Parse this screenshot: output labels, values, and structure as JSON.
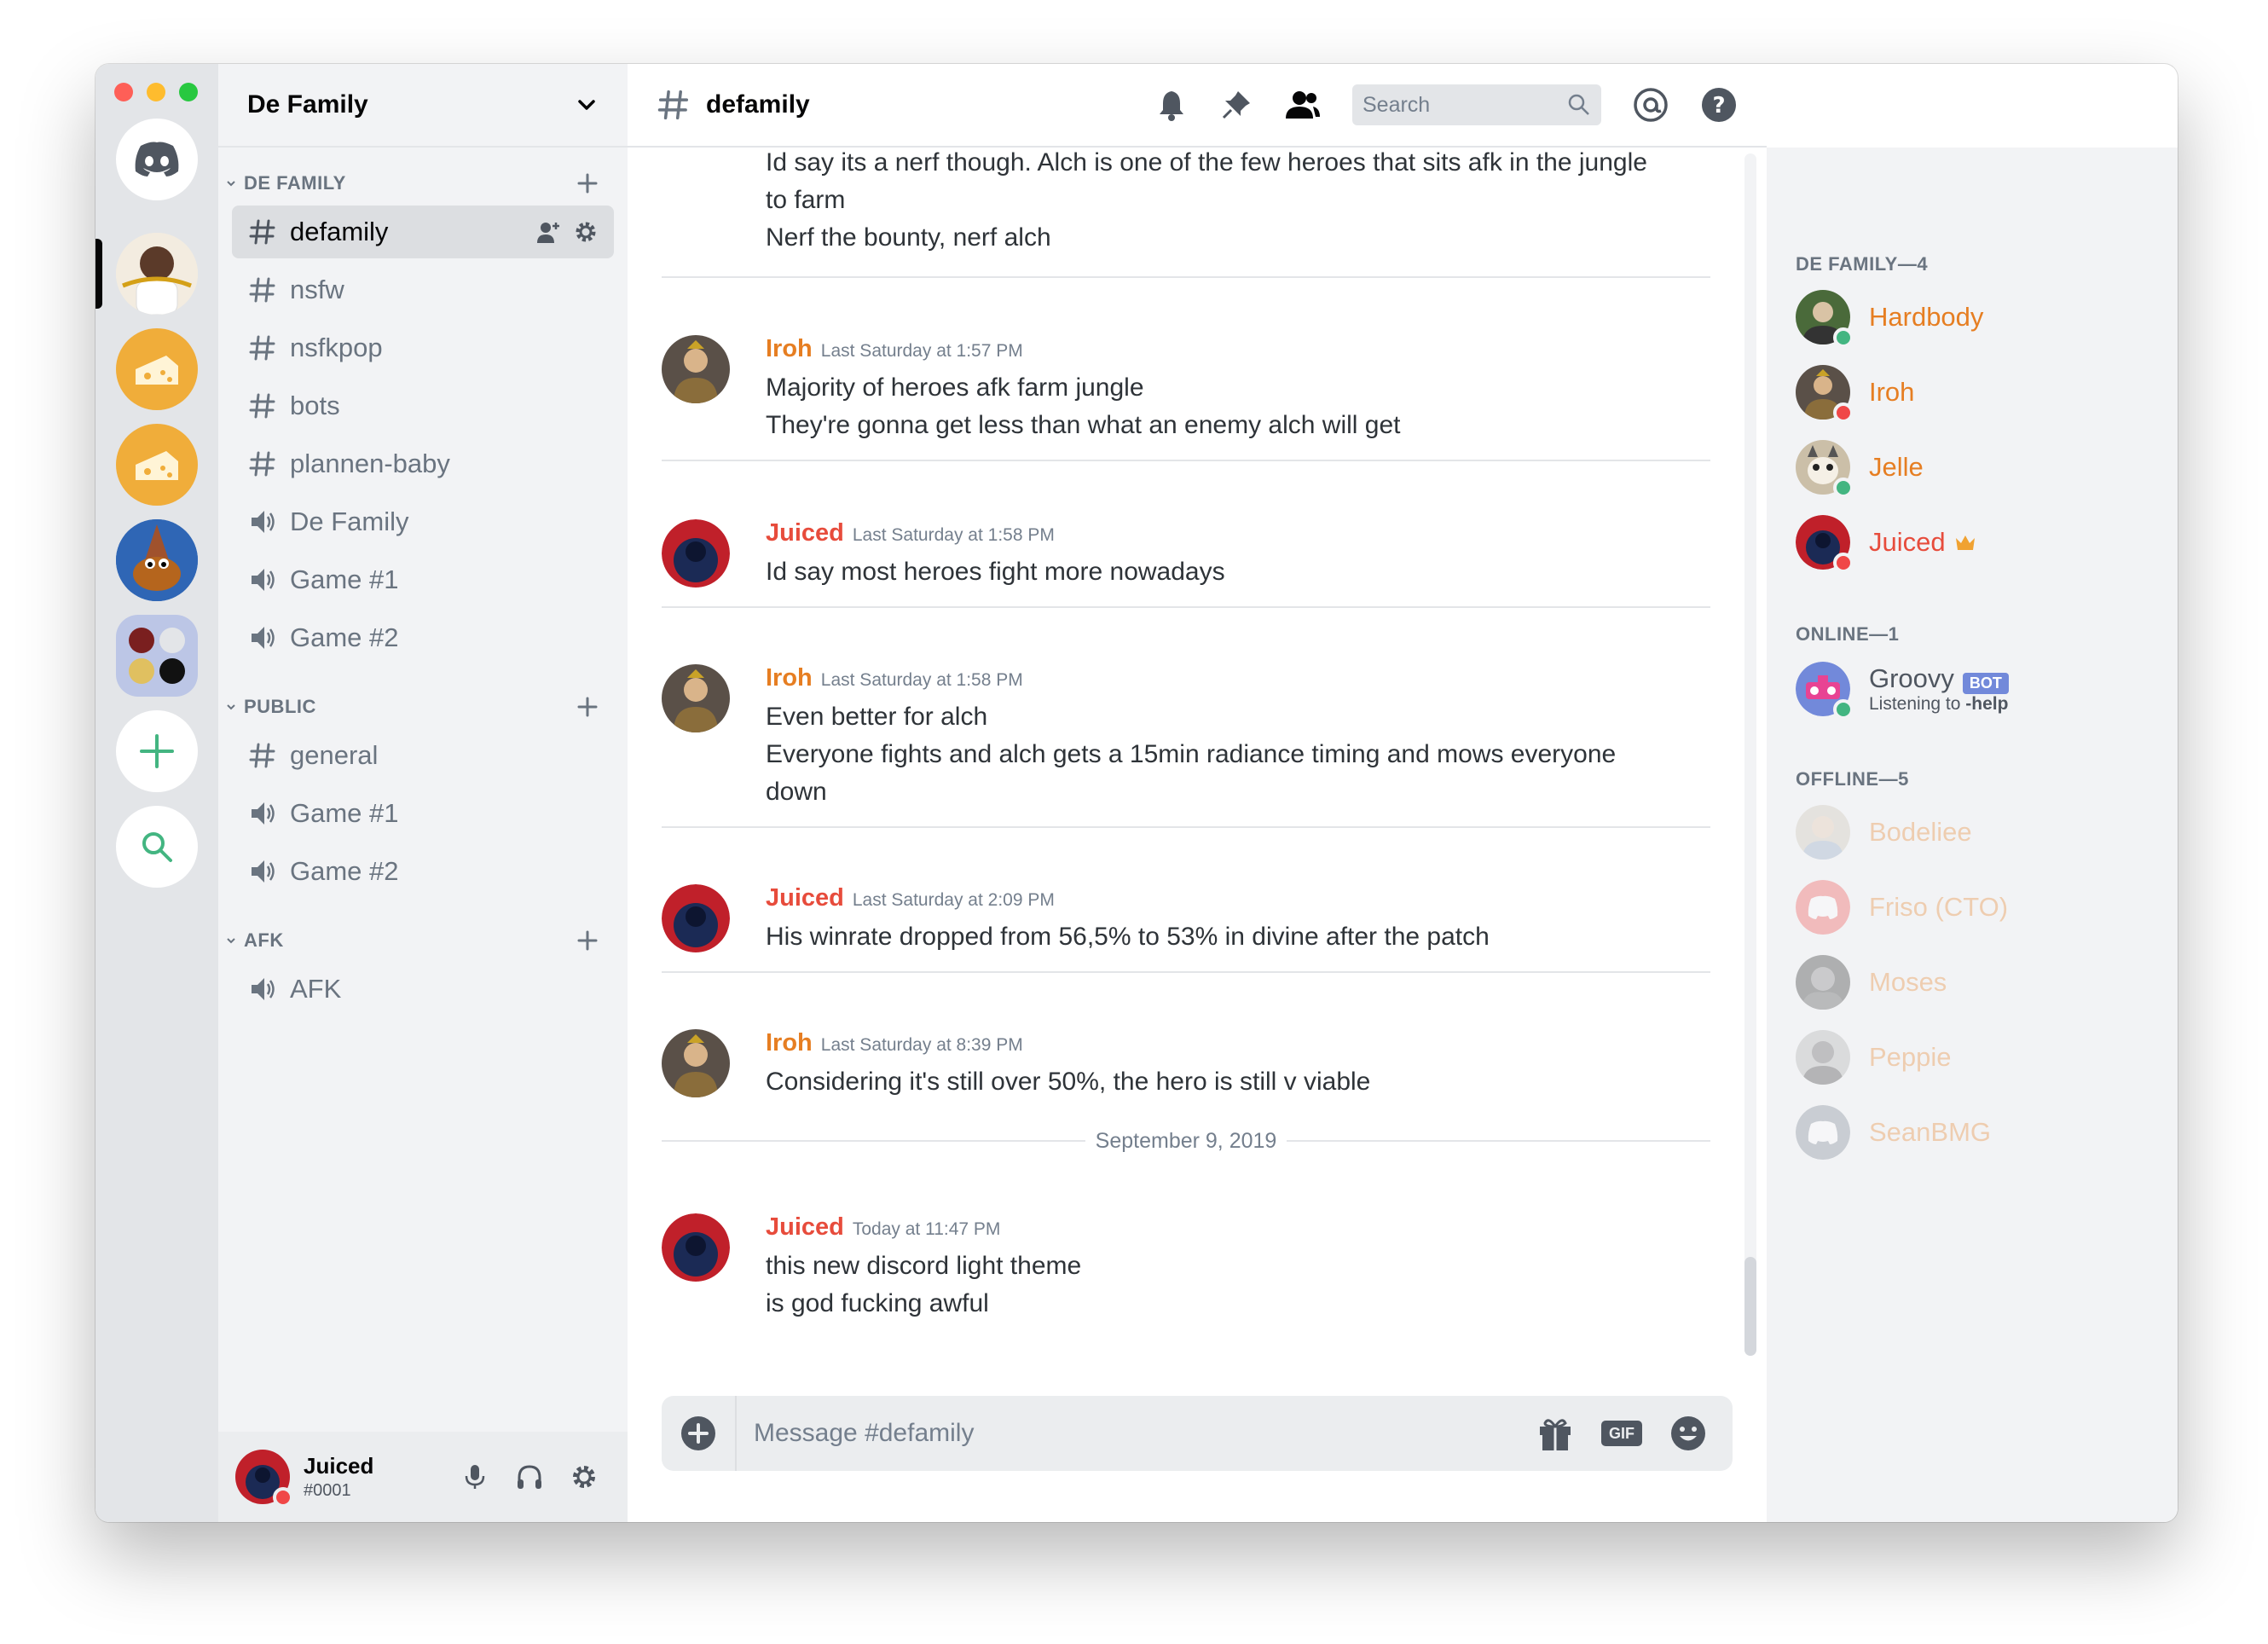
{
  "guild": {
    "name": "De Family"
  },
  "categories": [
    {
      "name": "DE FAMILY",
      "channels": [
        "defamily",
        "nsfw",
        "nsfkpop",
        "bots",
        "plannen-baby",
        "De Family",
        "Game #1",
        "Game #2"
      ]
    },
    {
      "name": "PUBLIC",
      "channels": [
        "general",
        "Game #1",
        "Game #2"
      ]
    },
    {
      "name": "AFK",
      "channels": [
        "AFK"
      ]
    }
  ],
  "user": {
    "name": "Juiced",
    "tag": "#0001"
  },
  "chat": {
    "channel": "defamily",
    "search_placeholder": "Search",
    "composer_placeholder": "Message #defamily",
    "gif_label": "GIF",
    "date_divider": "September 9, 2019"
  },
  "messages": [
    {
      "author": "",
      "timestamp": "",
      "lines": [
        "Id say its a nerf though. Alch is one of the few heroes that sits afk in the jungle",
        "to farm",
        "Nerf the bounty, nerf alch"
      ]
    },
    {
      "author": "Iroh",
      "timestamp": "Last Saturday at 1:57 PM",
      "lines": [
        "Majority of heroes afk farm jungle",
        "They're gonna get less than what an enemy alch will get"
      ]
    },
    {
      "author": "Juiced",
      "timestamp": "Last Saturday at 1:58 PM",
      "lines": [
        "Id say most heroes fight more nowadays"
      ]
    },
    {
      "author": "Iroh",
      "timestamp": "Last Saturday at 1:58 PM",
      "lines": [
        "Even better for alch",
        "Everyone fights and alch gets a 15min radiance timing and mows everyone",
        "down"
      ]
    },
    {
      "author": "Juiced",
      "timestamp": "Last Saturday at 2:09 PM",
      "lines": [
        "His winrate dropped from 56,5% to 53% in divine after the patch"
      ]
    },
    {
      "author": "Iroh",
      "timestamp": "Last Saturday at 8:39 PM",
      "lines": [
        "Considering it's still over 50%, the hero is still v viable"
      ]
    },
    {
      "author": "Juiced",
      "timestamp": "Today at 11:47 PM",
      "lines": [
        "this new discord light theme",
        "is god fucking awful"
      ]
    }
  ],
  "members": {
    "groups": [
      {
        "header": "DE FAMILY—4"
      },
      {
        "header": "ONLINE—1"
      },
      {
        "header": "OFFLINE—5"
      }
    ],
    "list": [
      {
        "name": "Hardbody"
      },
      {
        "name": "Iroh"
      },
      {
        "name": "Jelle"
      },
      {
        "name": "Juiced"
      },
      {
        "name": "Groovy",
        "tag": "BOT",
        "activity_prefix": "Listening to ",
        "activity": "-help"
      },
      {
        "name": "Bodeliee"
      },
      {
        "name": "Friso (CTO)"
      },
      {
        "name": "Moses"
      },
      {
        "name": "Peppie"
      },
      {
        "name": "SeanBMG"
      }
    ]
  },
  "colors": {
    "iroh": "#e67e22",
    "juiced": "#e74c3c",
    "online": "#43b581",
    "dnd": "#f04747",
    "blurple": "#7289da",
    "server_orange": "#f0ad3a"
  }
}
